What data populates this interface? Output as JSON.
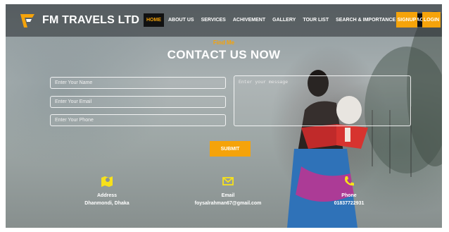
{
  "brand": {
    "name": "FM TRAVELS LTD"
  },
  "nav": {
    "items": [
      {
        "label": "HOME"
      },
      {
        "label": "ABOUT US"
      },
      {
        "label": "SERVICES"
      },
      {
        "label": "ACHIVEMENT"
      },
      {
        "label": "GALLERY"
      },
      {
        "label": "TOUR LIST"
      },
      {
        "label": "SEARCH & IMPORTANCE"
      },
      {
        "label": "CONTACT US"
      }
    ],
    "signup_label": "SIGNUP",
    "login_label": "LOGIN"
  },
  "hero": {
    "kicker": "Find Me",
    "title": "CONTACT US NOW"
  },
  "form": {
    "name_placeholder": "Enter Your Name",
    "email_placeholder": "Enter Your Email",
    "phone_placeholder": "Enter Your Phone",
    "message_placeholder": "Enter your message",
    "submit_label": "SUBMIT"
  },
  "contact": {
    "address": {
      "label": "Address",
      "value": "Dhanmondi, Dhaka"
    },
    "email": {
      "label": "Email",
      "value": "foysalrahman67@gmail.com"
    },
    "phone": {
      "label": "Phone",
      "value": "01837722931"
    }
  },
  "colors": {
    "accent": "#f5a30a",
    "icon_yellow": "#f7e11b",
    "nav_dark": "#111111"
  },
  "icons": [
    "logo-mark-icon",
    "map-icon",
    "envelope-icon",
    "phone-icon"
  ]
}
